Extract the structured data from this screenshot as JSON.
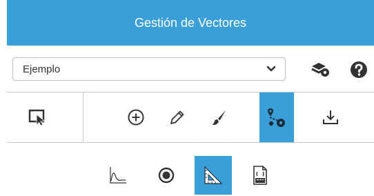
{
  "header": {
    "title": "Gestión de Vectores"
  },
  "selector": {
    "value": "Ejemplo",
    "caret_icon": "chevron-down-icon"
  },
  "actions": {
    "layers_icon": "layers-settings-icon",
    "help_icon": "help-icon"
  },
  "toolbar": {
    "items": [
      {
        "icon": "select-cursor-icon",
        "active": false
      },
      {
        "icon": "add-circle-icon",
        "active": false
      },
      {
        "icon": "pencil-icon",
        "active": false
      },
      {
        "icon": "brush-icon",
        "active": false
      },
      {
        "icon": "route-points-icon",
        "active": true
      },
      {
        "icon": "download-icon",
        "active": false
      }
    ]
  },
  "subtools": {
    "items": [
      {
        "icon": "line-chart-icon",
        "active": false
      },
      {
        "icon": "radio-target-icon",
        "active": false
      },
      {
        "icon": "triangle-ruler-icon",
        "active": true
      },
      {
        "icon": "csv-file-icon",
        "active": false
      }
    ]
  },
  "colors": {
    "accent": "#3a9ed8",
    "icon_dark": "#333333",
    "border": "#c8c8c8"
  }
}
